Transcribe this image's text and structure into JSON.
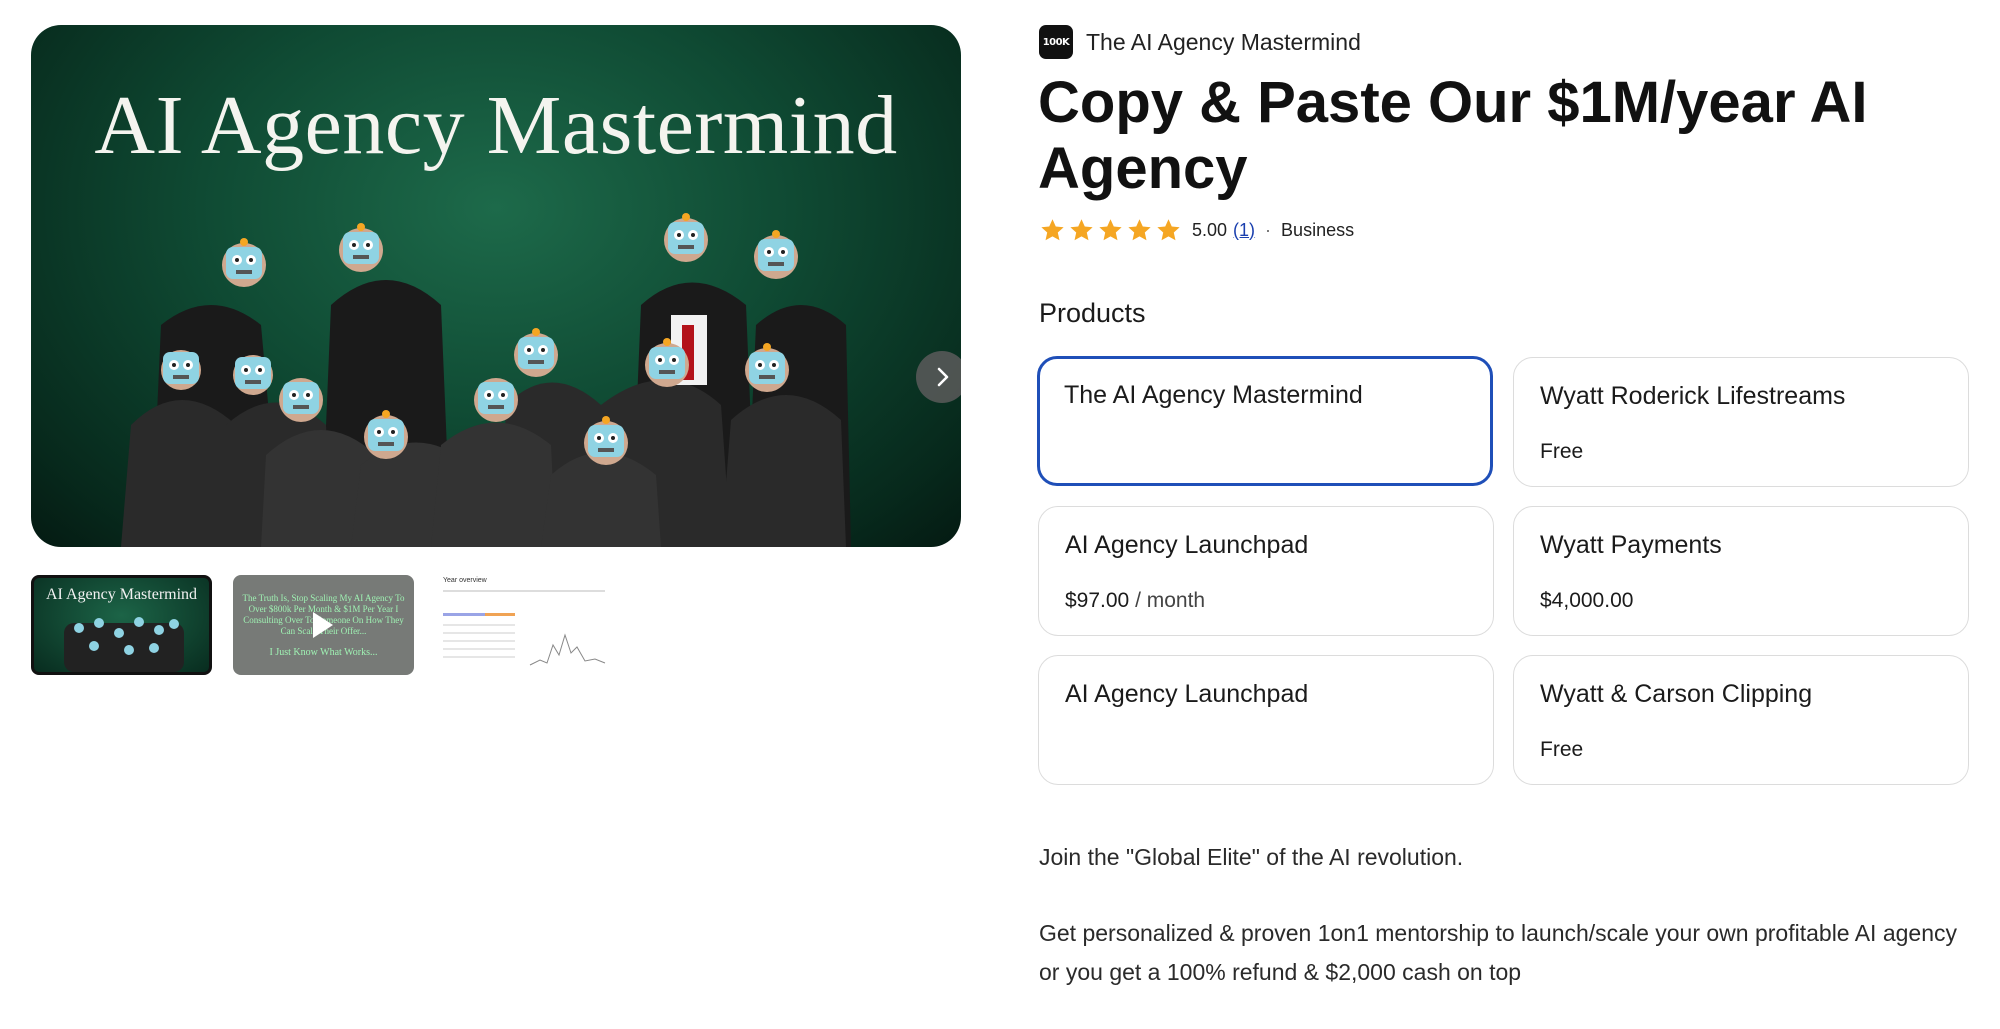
{
  "gallery": {
    "hero_title": "AI Agency Mastermind",
    "next_icon": "chevron-right-icon",
    "thumbnails": [
      {
        "title": "AI Agency Mastermind"
      },
      {
        "text": "The Truth Is, Stop Scaling My AI Agency To Over $800k Per Month & $1M Per Year I Consulting Over To Someone On How They Can Scale Their Offer...",
        "footer": "I Just Know What Works...",
        "icon": "play-icon"
      },
      {
        "title": "Year overview"
      }
    ]
  },
  "brand": {
    "logo_text": "100K",
    "name": "The AI Agency Mastermind"
  },
  "product": {
    "title": "Copy & Paste Our $1M/year AI Agency",
    "rating_value": "5.00",
    "rating_count": "(1)",
    "separator": "·",
    "category": "Business",
    "star_color": "#f5a623"
  },
  "products_heading": "Products",
  "products": [
    {
      "name": "The AI Agency Mastermind",
      "price": "",
      "unit": "",
      "selected": true
    },
    {
      "name": "Wyatt Roderick Lifestreams",
      "price": "Free",
      "unit": ""
    },
    {
      "name": "AI Agency Launchpad",
      "price": "$97.00",
      "unit": " / month"
    },
    {
      "name": "Wyatt Payments",
      "price": "$4,000.00",
      "unit": ""
    },
    {
      "name": "AI Agency Launchpad",
      "price": "",
      "unit": ""
    },
    {
      "name": "Wyatt & Carson Clipping",
      "price": "Free",
      "unit": ""
    }
  ],
  "description": [
    "Join the \"Global Elite\" of the AI revolution.",
    "Get personalized & proven 1on1 mentorship to launch/scale your own profitable AI agency or you get a 100% refund & $2,000 cash on top"
  ],
  "colors": {
    "selected_border": "#1f4fb8",
    "link": "#1a3fae"
  }
}
